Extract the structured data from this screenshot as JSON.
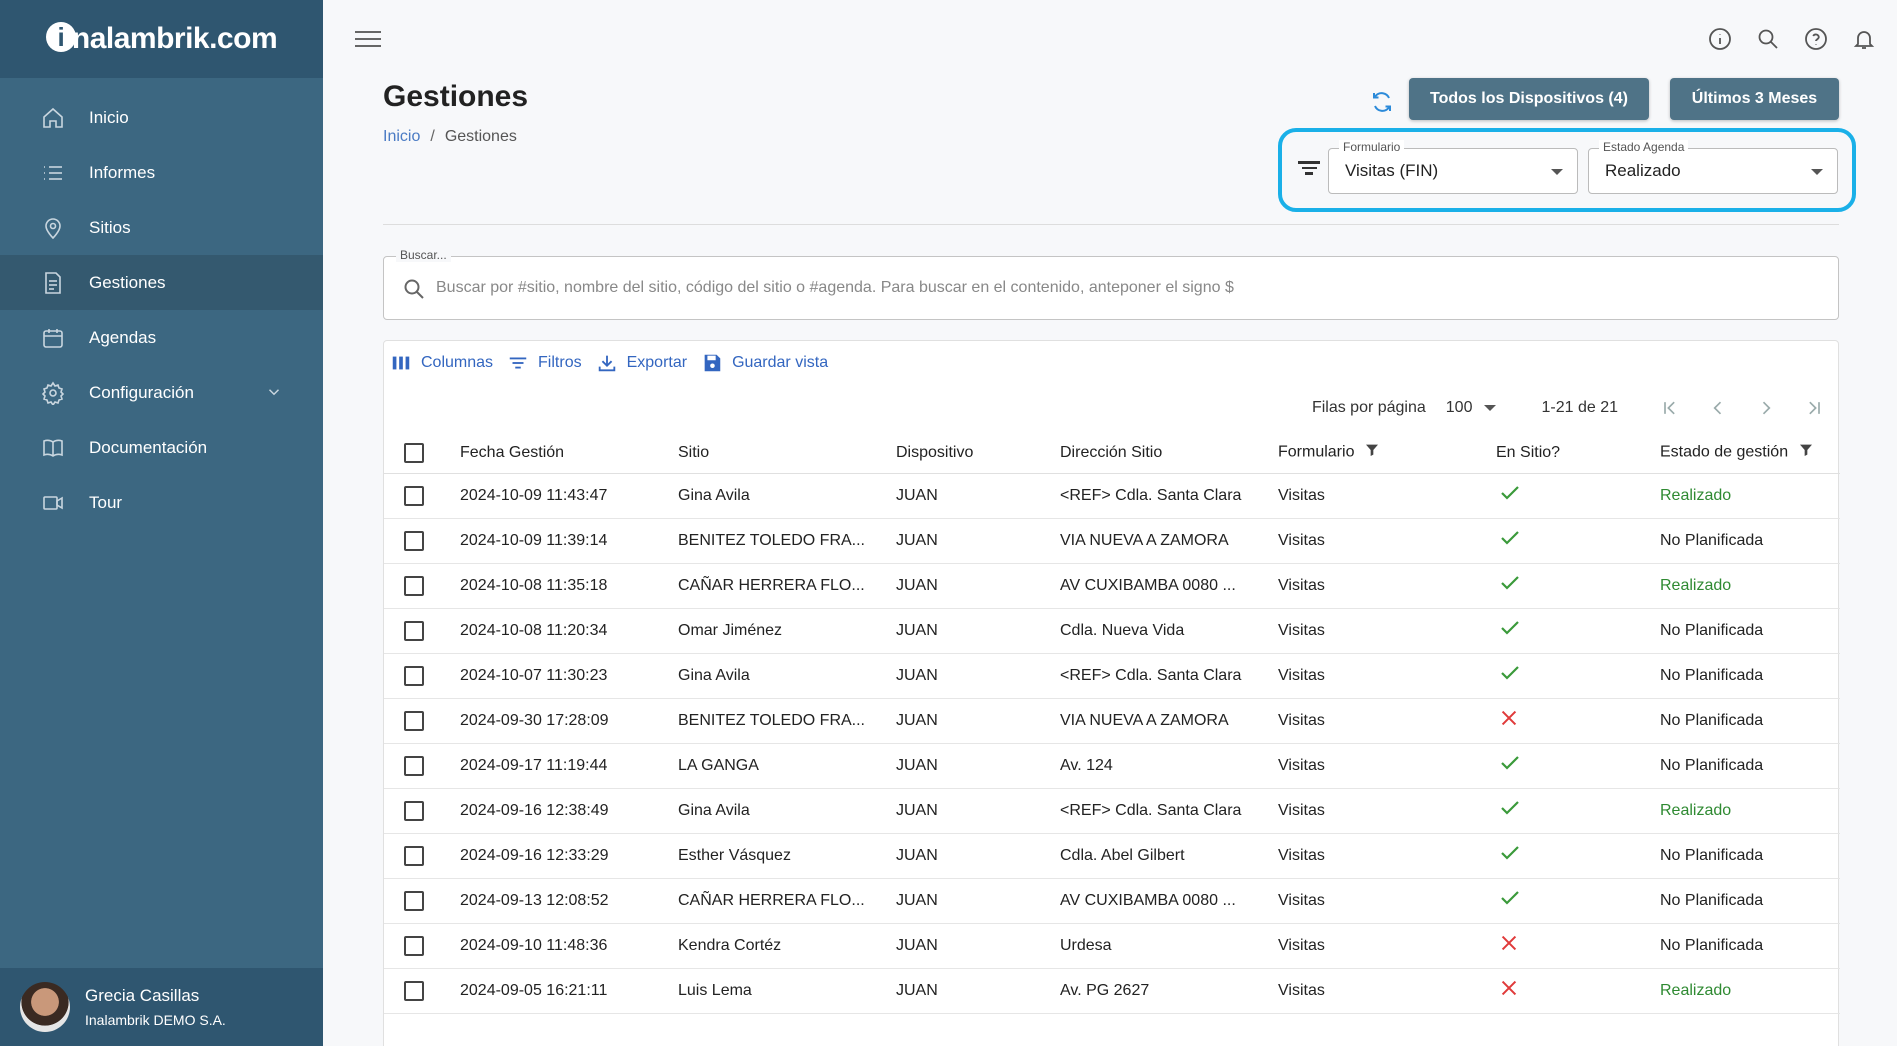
{
  "brand": {
    "logo_mark": "i",
    "logo_text": "nalambrik.com"
  },
  "sidebar": {
    "items": [
      {
        "label": "Inicio",
        "icon": "home-icon"
      },
      {
        "label": "Informes",
        "icon": "list-icon"
      },
      {
        "label": "Sitios",
        "icon": "location-pin-icon"
      },
      {
        "label": "Gestiones",
        "icon": "document-icon",
        "active": true
      },
      {
        "label": "Agendas",
        "icon": "calendar-icon"
      },
      {
        "label": "Configuración",
        "icon": "gear-icon",
        "expandable": true
      },
      {
        "label": "Documentación",
        "icon": "book-icon"
      },
      {
        "label": "Tour",
        "icon": "video-icon"
      }
    ],
    "user": {
      "name": "Grecia Casillas",
      "org": "Inalambrik DEMO S.A."
    }
  },
  "topbar": {
    "icons": [
      "info-icon",
      "search-icon",
      "help-icon",
      "bell-icon"
    ]
  },
  "page": {
    "title": "Gestiones",
    "breadcrumb": {
      "home": "Inicio",
      "current": "Gestiones"
    },
    "btn_devices": "Todos los Dispositivos (4)",
    "btn_months": "Últimos 3 Meses",
    "filters": {
      "form_label": "Formulario",
      "form_value": "Visitas (FIN)",
      "estado_label": "Estado Agenda",
      "estado_value": "Realizado"
    },
    "search": {
      "label": "Buscar...",
      "placeholder": "Buscar por #sitio, nombre del sitio, código del sitio o #agenda. Para buscar en el contenido, anteponer el signo $"
    }
  },
  "toolbar": {
    "columns": "Columnas",
    "filters": "Filtros",
    "export": "Exportar",
    "save": "Guardar vista"
  },
  "pager": {
    "rows_label": "Filas por página",
    "rows_value": "100",
    "range": "1-21 de 21"
  },
  "table": {
    "columns": [
      "Fecha Gestión",
      "Sitio",
      "Dispositivo",
      "Dirección Sitio",
      "Formulario",
      "En Sitio?",
      "Estado de gestión"
    ],
    "rows": [
      {
        "fecha": "2024-10-09 11:43:47",
        "sitio": "Gina Avila",
        "disp": "JUAN",
        "dir": "<REF> Cdla. Santa Clara",
        "form": "Visitas",
        "en_sitio": true,
        "estado": "Realizado"
      },
      {
        "fecha": "2024-10-09 11:39:14",
        "sitio": "BENITEZ TOLEDO FRA...",
        "disp": "JUAN",
        "dir": "VIA NUEVA A ZAMORA",
        "form": "Visitas",
        "en_sitio": true,
        "estado": "No Planificada"
      },
      {
        "fecha": "2024-10-08 11:35:18",
        "sitio": "CAÑAR HERRERA FLO...",
        "disp": "JUAN",
        "dir": "AV CUXIBAMBA 0080 ...",
        "form": "Visitas",
        "en_sitio": true,
        "estado": "Realizado"
      },
      {
        "fecha": "2024-10-08 11:20:34",
        "sitio": "Omar Jiménez",
        "disp": "JUAN",
        "dir": "Cdla. Nueva Vida",
        "form": "Visitas",
        "en_sitio": true,
        "estado": "No Planificada"
      },
      {
        "fecha": "2024-10-07 11:30:23",
        "sitio": "Gina Avila",
        "disp": "JUAN",
        "dir": "<REF> Cdla. Santa Clara",
        "form": "Visitas",
        "en_sitio": true,
        "estado": "No Planificada"
      },
      {
        "fecha": "2024-09-30 17:28:09",
        "sitio": "BENITEZ TOLEDO FRA...",
        "disp": "JUAN",
        "dir": "VIA NUEVA A ZAMORA",
        "form": "Visitas",
        "en_sitio": false,
        "estado": "No Planificada"
      },
      {
        "fecha": "2024-09-17 11:19:44",
        "sitio": "LA GANGA",
        "disp": "JUAN",
        "dir": "Av. 124",
        "form": "Visitas",
        "en_sitio": true,
        "estado": "No Planificada"
      },
      {
        "fecha": "2024-09-16 12:38:49",
        "sitio": "Gina Avila",
        "disp": "JUAN",
        "dir": "<REF> Cdla. Santa Clara",
        "form": "Visitas",
        "en_sitio": true,
        "estado": "Realizado"
      },
      {
        "fecha": "2024-09-16 12:33:29",
        "sitio": "Esther Vásquez",
        "disp": "JUAN",
        "dir": "Cdla. Abel Gilbert",
        "form": "Visitas",
        "en_sitio": true,
        "estado": "No Planificada"
      },
      {
        "fecha": "2024-09-13 12:08:52",
        "sitio": "CAÑAR HERRERA FLO...",
        "disp": "JUAN",
        "dir": "AV CUXIBAMBA 0080 ...",
        "form": "Visitas",
        "en_sitio": true,
        "estado": "No Planificada"
      },
      {
        "fecha": "2024-09-10 11:48:36",
        "sitio": "Kendra Cortéz",
        "disp": "JUAN",
        "dir": "Urdesa",
        "form": "Visitas",
        "en_sitio": false,
        "estado": "No Planificada"
      },
      {
        "fecha": "2024-09-05 16:21:11",
        "sitio": "Luis Lema",
        "disp": "JUAN",
        "dir": "Av. PG 2627",
        "form": "Visitas",
        "en_sitio": false,
        "estado": "Realizado"
      }
    ]
  },
  "colors": {
    "sidebar": "#3c6781",
    "sidebar_dark": "#2f5670",
    "button": "#4f7387",
    "highlight": "#1ab0e8",
    "link": "#3366c0",
    "success": "#2f8a32",
    "error": "#e03a3a"
  }
}
